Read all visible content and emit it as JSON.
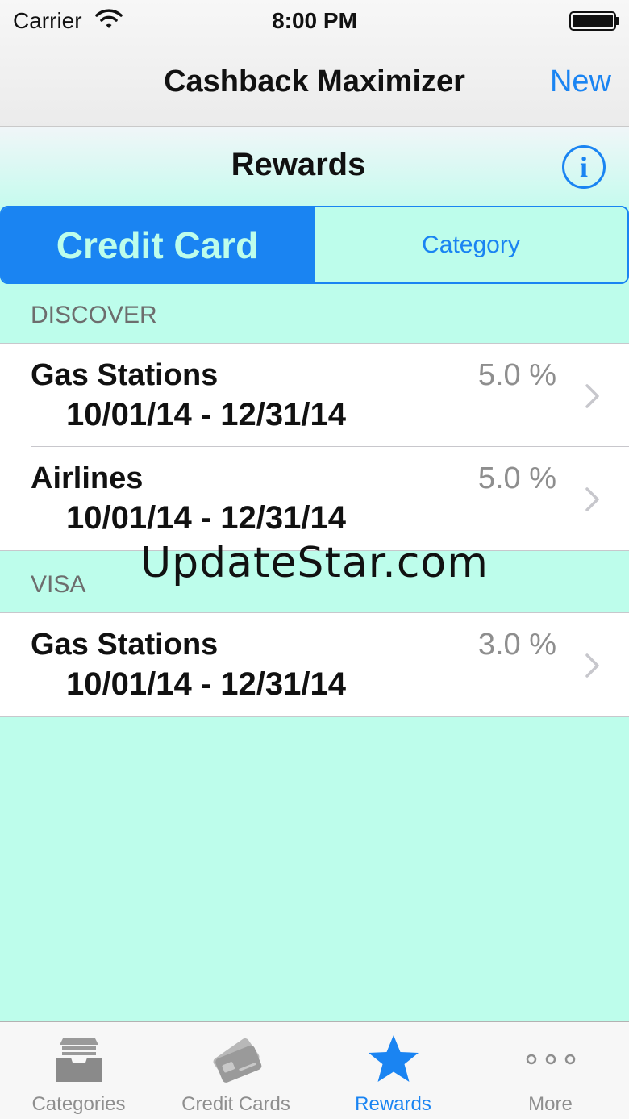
{
  "status_bar": {
    "carrier": "Carrier",
    "time": "8:00 PM"
  },
  "nav": {
    "title": "Cashback Maximizer",
    "new_label": "New"
  },
  "subheader": {
    "title": "Rewards",
    "info_glyph": "i"
  },
  "segmented": {
    "active_label": "Credit Card",
    "inactive_label": "Category"
  },
  "sections": [
    {
      "header": "DISCOVER",
      "rows": [
        {
          "title": "Gas Stations",
          "dates": "10/01/14 - 12/31/14",
          "value": "5.0 %"
        },
        {
          "title": "Airlines",
          "dates": "10/01/14 - 12/31/14",
          "value": "5.0 %"
        }
      ]
    },
    {
      "header": "VISA",
      "rows": [
        {
          "title": "Gas Stations",
          "dates": "10/01/14 - 12/31/14",
          "value": "3.0 %"
        }
      ]
    }
  ],
  "watermark": "UpdateStar.com",
  "tabbar": {
    "items": [
      {
        "label": "Categories",
        "icon": "inbox-tray-icon"
      },
      {
        "label": "Credit Cards",
        "icon": "credit-cards-icon"
      },
      {
        "label": "Rewards",
        "icon": "star-icon"
      },
      {
        "label": "More",
        "icon": "more-dots-icon"
      }
    ],
    "active_index": 2
  },
  "colors": {
    "accent": "#1a84f2",
    "background": "#bdfdeb",
    "row_background": "#ffffff",
    "secondary_text": "#8e8e8e"
  }
}
